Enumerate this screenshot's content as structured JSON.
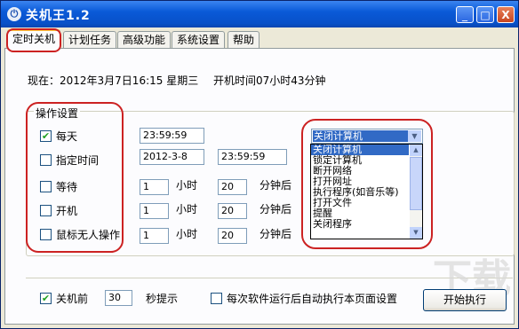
{
  "window": {
    "title": "关机王1.2",
    "minimize_glyph": "_",
    "maximize_glyph": "□",
    "close_glyph": "X",
    "app_icon": "power-icon"
  },
  "tabs": [
    "定时关机",
    "计划任务",
    "高级功能",
    "系统设置",
    "帮助"
  ],
  "status": {
    "now_label": "现在：",
    "now_value": "2012年3月7日16:15  星期三",
    "uptime": "开机时间07小时43分钟"
  },
  "settings": {
    "group_title": "操作设置",
    "rows": [
      {
        "label": "每天",
        "checked": "✔",
        "value1": "23:59:59"
      },
      {
        "label": "指定时间",
        "checked": "",
        "value1": "2012-3-8",
        "value2": "23:59:59"
      },
      {
        "label": "等待",
        "checked": "",
        "value1": "1",
        "unit1": "小时",
        "value2": "20",
        "unit2": "分钟后"
      },
      {
        "label": "开机",
        "checked": "",
        "value1": "1",
        "unit1": "小时",
        "value2": "20",
        "unit2": "分钟后"
      },
      {
        "label": "鼠标无人操作",
        "checked": "",
        "value1": "1",
        "unit1": "小时",
        "value2": "20",
        "unit2": "分钟后"
      }
    ]
  },
  "action": {
    "selected": "关闭计算机",
    "options": [
      "关闭计算机",
      "锁定计算机",
      "断开网络",
      "打开网址",
      "执行程序(如音乐等)",
      "打开文件",
      "提醒",
      "关闭程序"
    ]
  },
  "footer": {
    "prompt_checked": "✔",
    "prompt_label": "关机前",
    "prompt_seconds": "30",
    "prompt_suffix": "秒提示",
    "auto_label": "每次软件运行后自动执行本页面设置",
    "start_button": "开始执行"
  },
  "colors": {
    "highlight_red": "#cc2222",
    "selection_blue": "#316ac5",
    "title_blue": "#0a5ad8"
  }
}
